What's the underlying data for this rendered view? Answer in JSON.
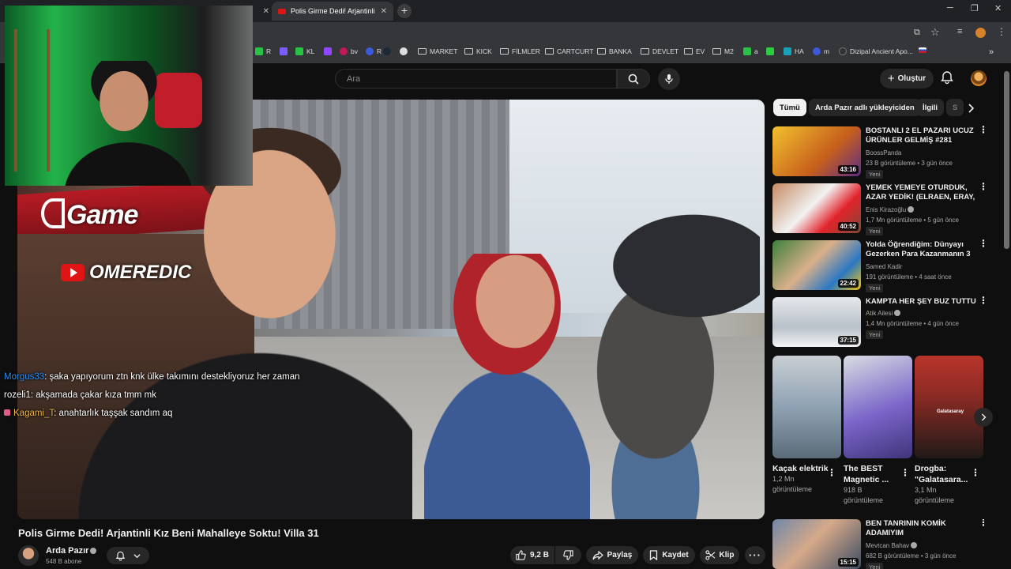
{
  "browser": {
    "tabs": [
      {
        "title": "Polis Girme Dedi! Arjantinli Kız",
        "active": true
      }
    ],
    "bookmarks": [
      {
        "label": "R",
        "color": "#27c246"
      },
      {
        "label": "KL",
        "color": "#27c246"
      },
      {
        "label": "bv",
        "color": "#c2185b"
      },
      {
        "label": "R",
        "color": "#3b5bdb"
      },
      {
        "label": "MARKET",
        "folder": true
      },
      {
        "label": "KICK",
        "folder": true
      },
      {
        "label": "FİLMLER",
        "folder": true
      },
      {
        "label": "CARTCURT",
        "folder": true
      },
      {
        "label": "BANKA",
        "folder": true
      },
      {
        "label": "DEVLET",
        "folder": true
      },
      {
        "label": "EV",
        "folder": true
      },
      {
        "label": "M2",
        "folder": true
      },
      {
        "label": "a",
        "color": "#27c246"
      },
      {
        "label": "HA",
        "color": "#17a2b8"
      },
      {
        "label": "m",
        "color": "#3b5bdb"
      },
      {
        "label": "Dizipal Ancient Apo...",
        "color": "#333"
      }
    ]
  },
  "header": {
    "search_placeholder": "Ara",
    "create_label": "Oluştur"
  },
  "overlay": {
    "brand_game": "Game",
    "brand_channel": "OMEREDIC",
    "chat": [
      {
        "user": "Morgus33",
        "text": ": şaka yapıyorum ztn knk ülke takımını destekliyoruz her zaman"
      },
      {
        "user": "rozeli1",
        "text": ": akşamada çakar kıza tmm mk"
      },
      {
        "user": "Kagami_T",
        "text": ": anahtarlık taşşak sandım aq"
      }
    ]
  },
  "video": {
    "title": "Polis Girme Dedi! Arjantinli Kız Beni Mahalleye Soktu! Villa 31",
    "channel": "Arda Pazır",
    "subscribers": "548 B abone",
    "likes": "9,2 B",
    "share_label": "Paylaş",
    "save_label": "Kaydet",
    "clip_label": "Klip"
  },
  "sidebar": {
    "chips": [
      "Tümü",
      "Arda Pazır adlı yükleyiciden",
      "İlgili",
      "S"
    ],
    "recommendations": [
      {
        "title": "BOSTANLI 2 EL PAZARI UCUZ ÜRÜNLER GELMİŞ #281",
        "channel": "BoossPanda",
        "meta": "23 B görüntüleme • 3 gün önce",
        "badge": "Yeni",
        "duration": "43:16",
        "thumb_color": "#e8a01c"
      },
      {
        "title": "YEMEK YEMEYE OTURDUK, AZAR YEDİK! (ELRAEN, ERAY, ...",
        "channel": "Enis Kirazoğlu",
        "meta": "1,7 Mn görüntüleme • 5 gün önce",
        "badge": "Yeni",
        "duration": "40:52",
        "thumb_color": "#9c6b4a"
      },
      {
        "title": "Yolda Öğrendiğim: Dünyayı Gezerken Para Kazanmanın 3 ...",
        "channel": "Samed Kadir",
        "meta": "191 görüntüleme • 4 saat önce",
        "badge": "Yeni",
        "duration": "22:42",
        "thumb_color": "#5c8f3e"
      },
      {
        "title": "KAMPTA HER ŞEY BUZ TUTTU",
        "channel": "Atik Ailesi",
        "meta": "1,4 Mn görüntüleme • 4 gün önce",
        "badge": "Yeni",
        "duration": "37:15",
        "thumb_color": "#d9dde2"
      },
      {
        "title": "BEN TANRININ KOMİK ADAMIYIM",
        "channel": "Mevtcan Bahav",
        "meta": "682 B görüntüleme • 3 gün önce",
        "badge": "Yeni",
        "duration": "15:15",
        "thumb_color": "#6f87a8"
      }
    ],
    "shorts": [
      {
        "title": "Kaçak elektrik",
        "views": "1,2 Mn",
        "views_label": "görüntüleme",
        "color": "#8fa2b3"
      },
      {
        "title": "The BEST Magnetic ...",
        "views": "918 B",
        "views_label": "görüntüleme",
        "color": "#7a65c9"
      },
      {
        "title": "Drogba: \"Galatasara...",
        "views": "3,1 Mn",
        "views_label": "görüntüleme",
        "color": "#8a2a24"
      }
    ],
    "short_overlay_text": "Galatasaray"
  }
}
